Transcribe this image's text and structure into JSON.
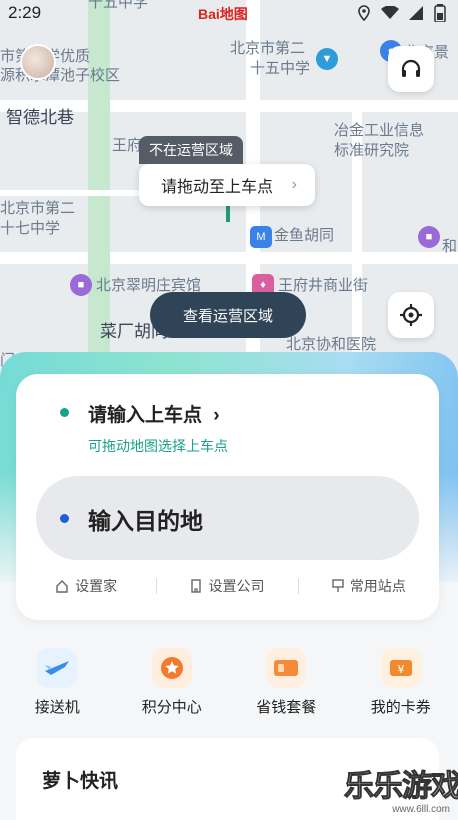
{
  "status_bar": {
    "time": "2:29",
    "icons": [
      "location-icon",
      "wifi-icon",
      "signal-icon",
      "battery-icon"
    ]
  },
  "map": {
    "logo": "Bai地图",
    "labels": {
      "top_partial": "十五中学",
      "school_a_line1": "市第二学优质",
      "school_a_line2": "源积水潭池子校区",
      "zhide": "智德北巷",
      "school_b_line1": "北京市第二",
      "school_b_line2": "十五中学",
      "right_partial": "北京景",
      "wangfu": "王府",
      "inst_line1": "冶金工业信息",
      "inst_line2": "标准研究院",
      "school_c_line1": "北京市第二",
      "school_c_line2": "十七中学",
      "jinyu": "金鱼胡同",
      "he": "和",
      "hotel": "北京翠明庄宾馆",
      "wangfujing": "王府井商业街",
      "caichang": "菜厂胡同",
      "xiehe": "北京协和医院",
      "men": "门"
    },
    "pin_tag": "不在运营区域",
    "pin_card": "请拖动至上车点",
    "view_area_button": "查看运营区域"
  },
  "card": {
    "pickup_title": "请输入上车点",
    "pickup_hint": "可拖动地图选择上车点",
    "destination_placeholder": "输入目的地",
    "quick": [
      "设置家",
      "设置公司",
      "常用站点"
    ]
  },
  "services": [
    {
      "label": "接送机",
      "icon": "airplane-icon"
    },
    {
      "label": "积分中心",
      "icon": "points-star-icon"
    },
    {
      "label": "省钱套餐",
      "icon": "package-ticket-icon"
    },
    {
      "label": "我的卡券",
      "icon": "coupon-icon"
    }
  ],
  "news": {
    "title": "萝卜快讯"
  },
  "watermark": {
    "text": "乐乐游戏",
    "sub": "www.6lll.com"
  },
  "colors": {
    "accent_green": "#19a28a",
    "dark_pill": "#2f4456",
    "blue_dot": "#1f5fd6"
  }
}
